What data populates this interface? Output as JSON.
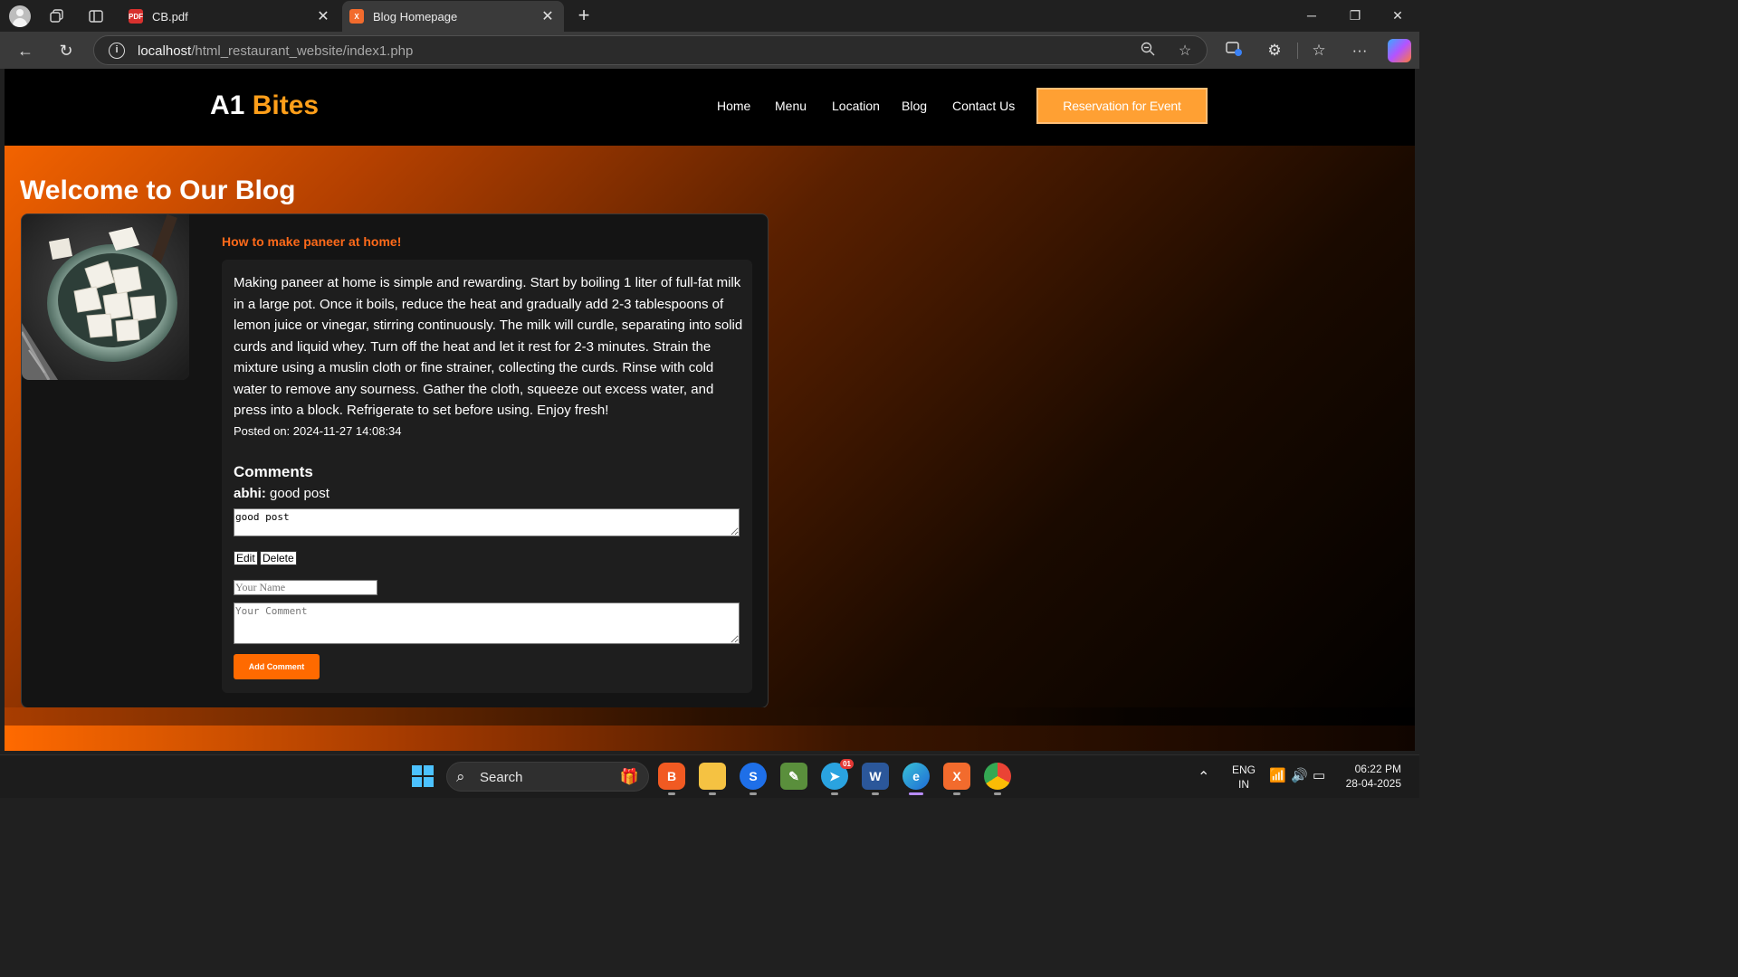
{
  "browser": {
    "tabs": [
      {
        "title": "CB.pdf",
        "favicon": "PDF",
        "active": false
      },
      {
        "title": "Blog Homepage",
        "favicon": "X",
        "active": true
      }
    ],
    "url_host": "localhost",
    "url_path": "/html_restaurant_website/index1.php"
  },
  "site": {
    "logo_main": "A1",
    "logo_accent": "Bites",
    "nav": [
      "Home",
      "Menu",
      "Location",
      "Blog",
      "Contact Us"
    ],
    "reserve_label": "Reservation for Event",
    "accent_color": "#ff9f1a"
  },
  "page": {
    "title": "Welcome to Our Blog"
  },
  "post": {
    "title": "How to make paneer at home!",
    "body": "Making paneer at home is simple and rewarding. Start by boiling 1 liter of full-fat milk in a large pot. Once it boils, reduce the heat and gradually add 2-3 tablespoons of lemon juice or vinegar, stirring continuously. The milk will curdle, separating into solid curds and liquid whey. Turn off the heat and let it rest for 2-3 minutes. Strain the mixture using a muslin cloth or fine strainer, collecting the curds. Rinse with cold water to remove any sourness. Gather the cloth, squeeze out excess water, and press into a block. Refrigerate to set before using. Enjoy fresh!",
    "posted_on": "Posted on: 2024-11-27 14:08:34",
    "comments_heading": "Comments",
    "comments": [
      {
        "author": "abhi:",
        "text": "good post",
        "edit_value": "good post"
      }
    ],
    "edit_label": "Edit",
    "delete_label": "Delete",
    "name_placeholder": "Your Name",
    "comment_placeholder": "Your Comment",
    "add_comment_label": "Add Comment"
  },
  "taskbar": {
    "search_label": "Search",
    "lang": "ENG",
    "region": "IN",
    "time": "06:22 PM",
    "date": "28-04-2025",
    "telegram_badge": "01"
  }
}
